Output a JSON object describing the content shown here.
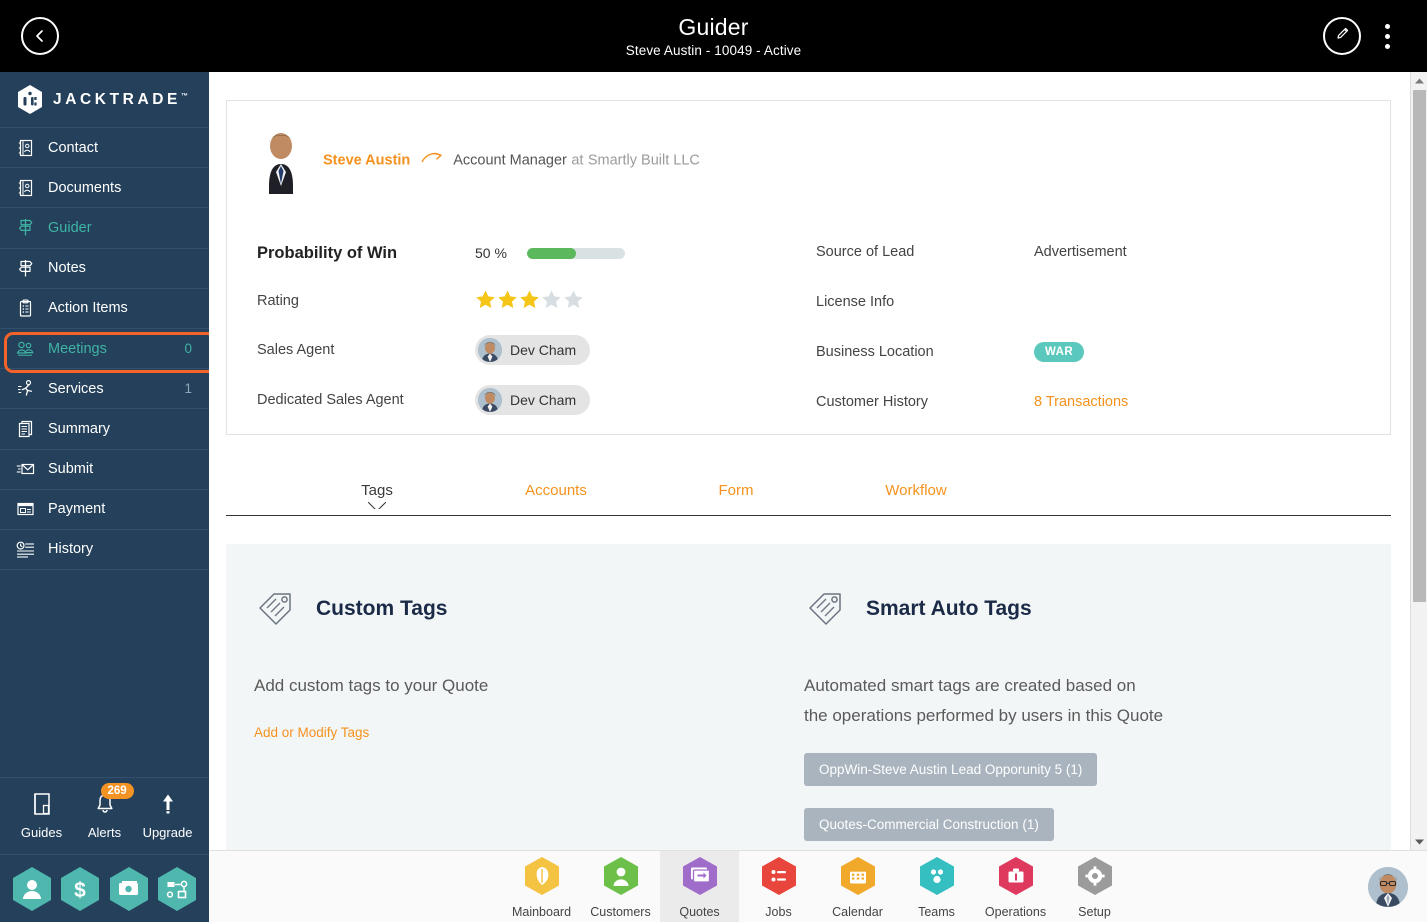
{
  "topbar": {
    "back_icon": "chevron-left-icon",
    "title": "Guider",
    "subtitle": "Steve Austin - 10049 - Active",
    "edit_icon": "pencil-icon",
    "menu_icon": "kebab-menu-icon"
  },
  "sidebar": {
    "brand": "JACKTRADE",
    "brand_tm": "™",
    "items": [
      {
        "label": "Contact",
        "icon": "contact-book-icon",
        "count": "",
        "active": false
      },
      {
        "label": "Documents",
        "icon": "documents-icon",
        "count": "",
        "active": false
      },
      {
        "label": "Guider",
        "icon": "guidepost-icon",
        "count": "",
        "active": true
      },
      {
        "label": "Notes",
        "icon": "notes-icon",
        "count": "",
        "active": false
      },
      {
        "label": "Action Items",
        "icon": "clipboard-icon",
        "count": "",
        "active": false
      },
      {
        "label": "Meetings",
        "icon": "meetings-icon",
        "count": "0",
        "active": true
      },
      {
        "label": "Services",
        "icon": "runner-icon",
        "count": "1",
        "active": false
      },
      {
        "label": "Summary",
        "icon": "summary-icon",
        "count": "",
        "active": false
      },
      {
        "label": "Submit",
        "icon": "send-mail-icon",
        "count": "",
        "active": false
      },
      {
        "label": "Payment",
        "icon": "payment-card-icon",
        "count": "",
        "active": false
      },
      {
        "label": "History",
        "icon": "history-clock-icon",
        "count": "",
        "active": false
      }
    ],
    "footer": [
      {
        "label": "Guides",
        "icon": "book-icon",
        "badge": ""
      },
      {
        "label": "Alerts",
        "icon": "bell-icon",
        "badge": "269"
      },
      {
        "label": "Upgrade",
        "icon": "arrow-up-icon",
        "badge": ""
      }
    ],
    "quick_actions": [
      {
        "icon": "person-hex-icon"
      },
      {
        "icon": "dollar-hex-icon"
      },
      {
        "icon": "money-hex-icon"
      },
      {
        "icon": "workflow-hex-icon"
      }
    ],
    "highlight_color": "#f4632a"
  },
  "card": {
    "person": {
      "name": "Steve Austin",
      "arrow_icon": "curved-arrow-icon",
      "role": "Account Manager",
      "at": "at",
      "company": "Smartly Built LLC"
    },
    "left_fields": [
      {
        "label": "Probability of Win",
        "type": "progress",
        "percent_text": "50 %",
        "percent": 50
      },
      {
        "label": "Rating",
        "type": "stars",
        "filled": 3,
        "total": 5
      },
      {
        "label": "Sales Agent",
        "type": "chip",
        "value": "Dev Cham"
      },
      {
        "label": "Dedicated Sales Agent",
        "type": "chip",
        "value": "Dev Cham"
      }
    ],
    "right_fields": [
      {
        "label": "Source of Lead",
        "type": "text",
        "value": "Advertisement"
      },
      {
        "label": "License Info",
        "type": "text",
        "value": ""
      },
      {
        "label": "Business Location",
        "type": "badge",
        "value": "WAR"
      },
      {
        "label": "Customer History",
        "type": "link",
        "value": "8 Transactions"
      }
    ],
    "colors": {
      "accent": "#f5921e",
      "progress": "#5cb85c",
      "badge": "#5bc8bd",
      "star": "#f5c518"
    }
  },
  "tabs": [
    {
      "label": "Tags",
      "active": true
    },
    {
      "label": "Accounts",
      "active": false
    },
    {
      "label": "Form",
      "active": false
    },
    {
      "label": "Workflow",
      "active": false
    }
  ],
  "panel": {
    "left": {
      "icon": "tag-icon",
      "title": "Custom Tags",
      "body": "Add custom tags to your Quote",
      "link": "Add or Modify Tags"
    },
    "right": {
      "icon": "tag-icon",
      "title": "Smart Auto Tags",
      "body": "Automated smart tags are created based on the operations performed by users in this Quote",
      "tags": [
        "OppWin-Steve Austin Lead Opporunity 5 (1)",
        "Quotes-Commercial Construction (1)"
      ]
    }
  },
  "bottombar": {
    "items": [
      {
        "label": "Mainboard",
        "icon": "mainboard-icon",
        "color": "#f5c342",
        "selected": false
      },
      {
        "label": "Customers",
        "icon": "customers-icon",
        "color": "#6cc04a",
        "selected": false
      },
      {
        "label": "Quotes",
        "icon": "quotes-icon",
        "color": "#a06cc9",
        "selected": true
      },
      {
        "label": "Jobs",
        "icon": "jobs-icon",
        "color": "#e8453c",
        "selected": false
      },
      {
        "label": "Calendar",
        "icon": "calendar-icon",
        "color": "#f0a92b",
        "selected": false
      },
      {
        "label": "Teams",
        "icon": "teams-icon",
        "color": "#35bfc0",
        "selected": false
      },
      {
        "label": "Operations",
        "icon": "operations-icon",
        "color": "#e0395e",
        "selected": false
      },
      {
        "label": "Setup",
        "icon": "setup-gear-icon",
        "color": "#9b9b9b",
        "selected": false
      }
    ],
    "avatar": "user-avatar"
  },
  "scrollbar": {
    "up_icon": "scroll-up-icon",
    "down_icon": "scroll-down-icon"
  }
}
